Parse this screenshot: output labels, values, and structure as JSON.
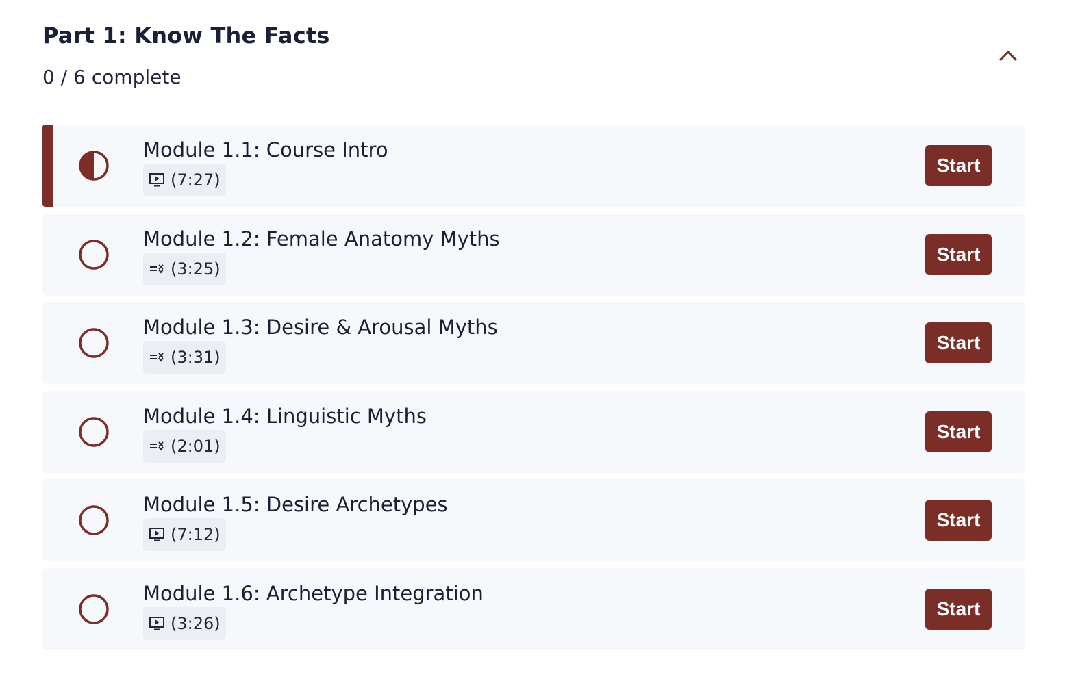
{
  "section": {
    "title": "Part 1: Know The Facts",
    "progress": "0 / 6 complete",
    "collapse_icon": "chevron-up-icon"
  },
  "colors": {
    "accent": "#7b2e28",
    "row_bg": "#f7f8fc",
    "pill_bg": "#eceef4",
    "text": "#1c2033"
  },
  "modules": [
    {
      "title": "Module 1.1: Course Intro",
      "duration": "(7:27)",
      "type": "video",
      "type_icon": "video-play-icon",
      "status": "in-progress",
      "status_icon": "half-circle-icon",
      "button": "Start"
    },
    {
      "title": "Module 1.2: Female Anatomy Myths",
      "duration": "(3:25)",
      "type": "quiz",
      "type_icon": "quiz-list-icon",
      "status": "not-started",
      "status_icon": "empty-circle-icon",
      "button": "Start"
    },
    {
      "title": "Module 1.3: Desire & Arousal Myths",
      "duration": "(3:31)",
      "type": "quiz",
      "type_icon": "quiz-list-icon",
      "status": "not-started",
      "status_icon": "empty-circle-icon",
      "button": "Start"
    },
    {
      "title": "Module 1.4: Linguistic Myths",
      "duration": "(2:01)",
      "type": "quiz",
      "type_icon": "quiz-list-icon",
      "status": "not-started",
      "status_icon": "empty-circle-icon",
      "button": "Start"
    },
    {
      "title": "Module 1.5: Desire Archetypes",
      "duration": "(7:12)",
      "type": "video",
      "type_icon": "video-play-icon",
      "status": "not-started",
      "status_icon": "empty-circle-icon",
      "button": "Start"
    },
    {
      "title": "Module 1.6: Archetype Integration",
      "duration": "(3:26)",
      "type": "video",
      "type_icon": "video-play-icon",
      "status": "not-started",
      "status_icon": "empty-circle-icon",
      "button": "Start"
    }
  ]
}
